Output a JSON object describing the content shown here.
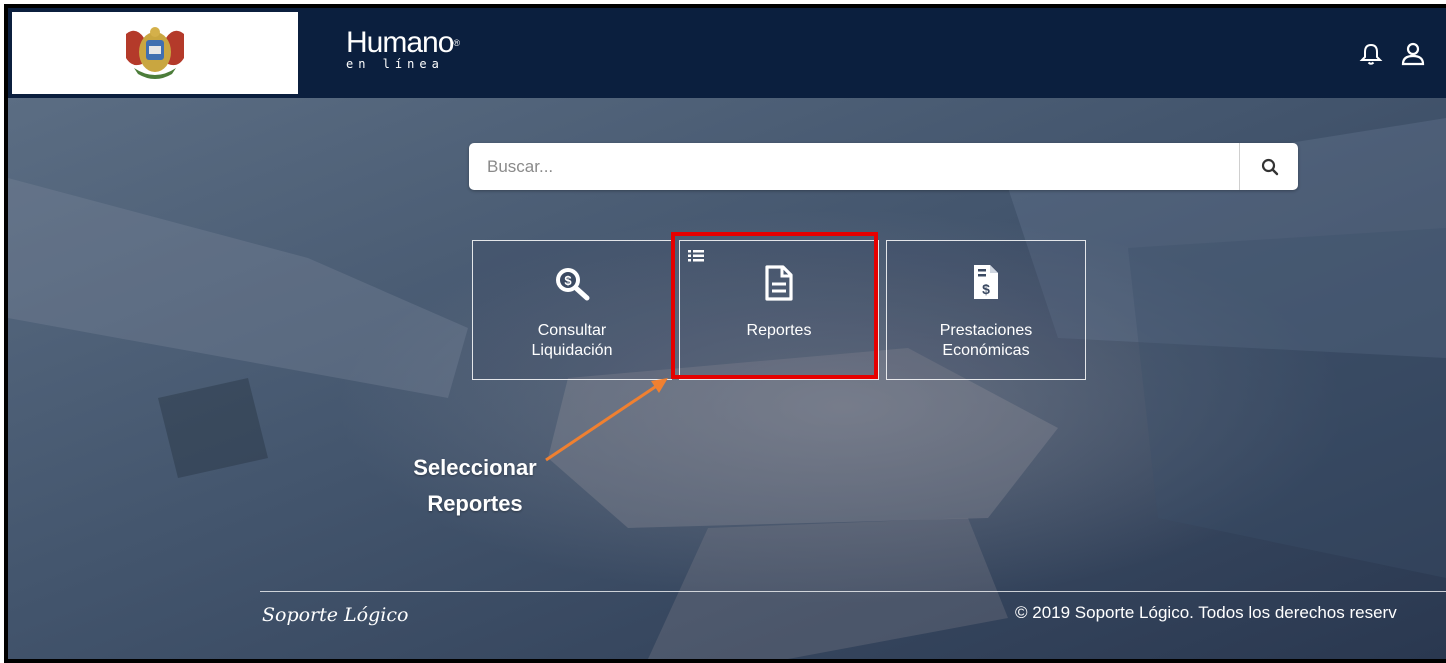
{
  "header": {
    "brand_main": "Humano",
    "brand_reg": "®",
    "brand_sub": "en línea",
    "icons": [
      "bell-icon",
      "user-icon"
    ]
  },
  "search": {
    "placeholder": "Buscar...",
    "button_icon": "search-icon"
  },
  "tiles": [
    {
      "label_line1": "Consultar",
      "label_line2": "Liquidación",
      "icon": "search-dollar-icon"
    },
    {
      "label_line1": "Reportes",
      "label_line2": "",
      "icon": "document-icon",
      "badge_icon": "list-icon"
    },
    {
      "label_line1": "Prestaciones",
      "label_line2": "Económicas",
      "icon": "invoice-dollar-icon"
    }
  ],
  "annotation": {
    "line1": "Seleccionar",
    "line2": "Reportes"
  },
  "footer": {
    "logo": "Soporte Lógico",
    "copyright": "© 2019 Soporte Lógico. Todos los derechos reserv"
  },
  "colors": {
    "header_bg": "#0b1f3e",
    "highlight": "#e50000",
    "arrow": "#f08030"
  }
}
